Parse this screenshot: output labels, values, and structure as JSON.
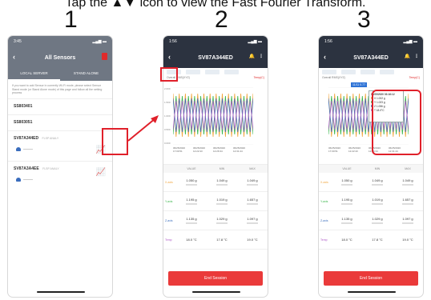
{
  "caption": {
    "prefix": "Tap the",
    "icon_name": "fft-icon",
    "suffix": "icon to view the Fast Fourier Transform."
  },
  "steps": [
    "1",
    "2",
    "3"
  ],
  "phone1": {
    "time": "3:45",
    "title": "All Sensors",
    "tabs": [
      "LOCAL SERVER",
      "STAND ALONE"
    ],
    "note": "If you want to add Sensor in currently Wi-Fi mode, please select Sensor Stand mode (or Stand Alone mode) of this page and follow all the setting process",
    "sensors": [
      {
        "name": "SS803401"
      },
      {
        "name": "SS803051"
      },
      {
        "name": "SV87A344ED",
        "sub": "FLSP ANALY"
      },
      {
        "name": "SV87A3A4EE",
        "sub": "FLSP ANALY"
      }
    ],
    "accent": "#e02b2b"
  },
  "phone2": {
    "time": "1:56",
    "title": "SV87A344ED",
    "legend_left": "Overall RMS(XYZ)",
    "legend_right": "Temp(C)",
    "yticks": [
      "2.000",
      "1.500",
      "1.000",
      "0.500",
      "0.000"
    ],
    "xticks": [
      "06/25/2020 17:00:51",
      "06/25/2020 12:22:43",
      "06/25/2020 12:26:34",
      "06/25/2020 12:31:44"
    ],
    "table_head": [
      "",
      "VALUE",
      "MIN",
      "MAX"
    ],
    "rows": [
      {
        "label": "X-axis",
        "color": "#f0a53c",
        "v": [
          "1.050 g",
          "1.049 g",
          "1.049 g"
        ]
      },
      {
        "label": "Y-axis",
        "color": "#39b54a",
        "v": [
          "1.195 g",
          "1.019 g",
          "1.657 g"
        ]
      },
      {
        "label": "Z-axis",
        "color": "#3a6dbd",
        "v": [
          "1.135 g",
          "1.029 g",
          "1.097 g"
        ]
      },
      {
        "label": "Temp",
        "color": "#b05cc8",
        "v": [
          "18.0 °C",
          "17.8 °C",
          "19.0 °C"
        ]
      }
    ],
    "end_button": "End Session"
  },
  "phone3": {
    "time": "1:56",
    "title": "SV87A344ED",
    "badge": "11/11 0.77",
    "tooltip": {
      "header": "06/25/2020 03:16:12",
      "lines": [
        "X 1.002 g",
        "Y 1.023 g",
        "Z 1.056 g",
        "T 18.0°C"
      ]
    },
    "end_button": "End Session"
  },
  "colors": {
    "x": "#f0a53c",
    "y": "#39b54a",
    "z": "#3a6dbd",
    "t": "#b05cc8",
    "highlight": "#e0202a"
  }
}
